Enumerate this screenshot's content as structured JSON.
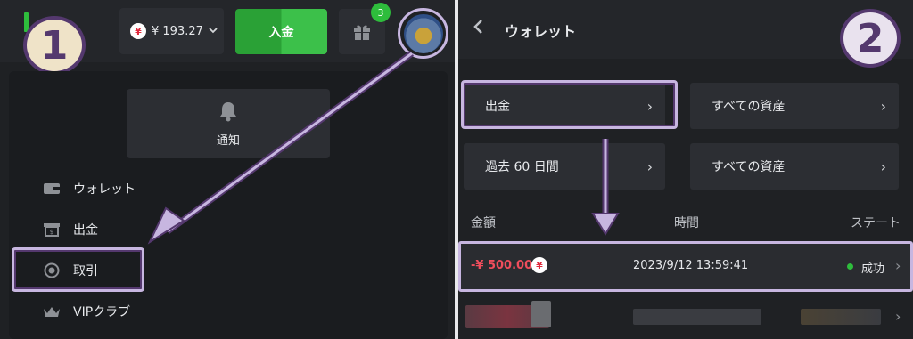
{
  "left": {
    "step_number": "1",
    "balance": {
      "currency_symbol": "¥",
      "amount": "¥ 193.27"
    },
    "deposit_label": "入金",
    "gift_count": "3",
    "notification_label": "通知",
    "menu_items": [
      {
        "label": "ウォレット",
        "icon": "wallet-icon"
      },
      {
        "label": "出金",
        "icon": "withdraw-icon"
      },
      {
        "label": "取引",
        "icon": "transaction-icon"
      },
      {
        "label": "VIPクラブ",
        "icon": "crown-icon"
      }
    ]
  },
  "right": {
    "step_number": "2",
    "title": "ウォレット",
    "filters": [
      {
        "label": "出金"
      },
      {
        "label": "すべての資産"
      },
      {
        "label": "過去 60 日間"
      },
      {
        "label": "すべての資産"
      }
    ],
    "columns": {
      "amount": "金額",
      "time": "時間",
      "status": "ステート"
    },
    "transaction": {
      "amount": "-¥ 500.00",
      "currency_symbol": "¥",
      "time": "2023/9/12 13:59:41",
      "status": "成功"
    }
  },
  "colors": {
    "accent_green": "#2ebd3c",
    "highlight": "#c7b6e0",
    "badge_purple": "#54386e",
    "negative_red": "#f04d5c"
  }
}
